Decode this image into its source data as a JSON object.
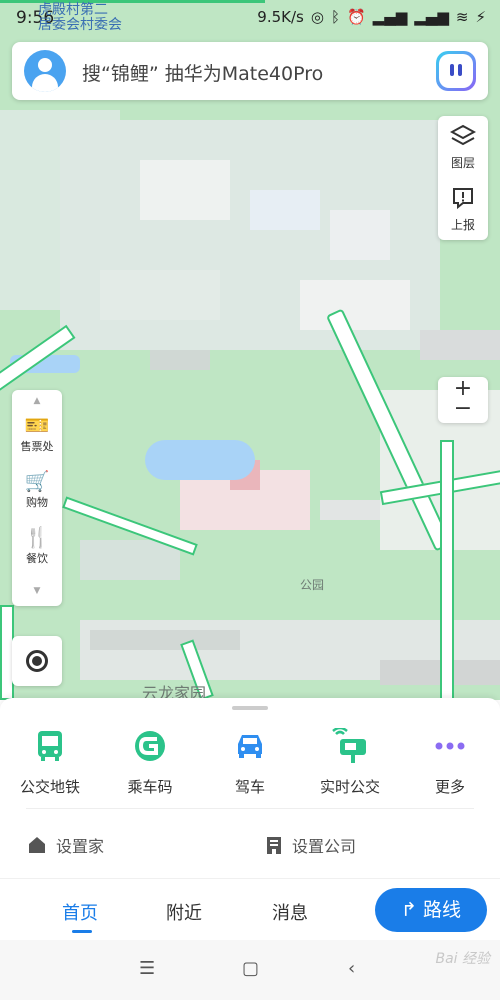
{
  "status": {
    "time": "9:56",
    "network_speed": "9.5K/s",
    "village_line1": "虎殿村第二",
    "village_line2": "居委会村委会"
  },
  "search": {
    "placeholder": "搜“锦鲤” 抽华为Mate40Pro"
  },
  "right_tools": {
    "layers_label": "图层",
    "report_label": "上报",
    "zoom_in": "+",
    "zoom_out": "−"
  },
  "left_tools": {
    "items": [
      {
        "label": "售票处",
        "icon": "ticket-icon"
      },
      {
        "label": "购物",
        "icon": "cart-icon"
      },
      {
        "label": "餐饮",
        "icon": "fork-knife-icon"
      }
    ]
  },
  "map": {
    "park_label": "公园",
    "bottom_label": "云龙家园"
  },
  "quick": [
    {
      "label": "公交地铁",
      "icon": "bus-icon",
      "color": "#2bc38a"
    },
    {
      "label": "乘车码",
      "icon": "ride-code-icon",
      "color": "#2bc38a"
    },
    {
      "label": "驾车",
      "icon": "car-icon",
      "color": "#2f8ef0"
    },
    {
      "label": "实时公交",
      "icon": "realtime-bus-icon",
      "color": "#2bc38a"
    },
    {
      "label": "更多",
      "icon": "more-dots-icon",
      "color": "#8b6cf2"
    }
  ],
  "shortcuts": {
    "home": "设置家",
    "company": "设置公司"
  },
  "tabs": {
    "home": "首页",
    "nearby": "附近",
    "messages": "消息",
    "route": "路线"
  },
  "watermark": "Bai 经验"
}
